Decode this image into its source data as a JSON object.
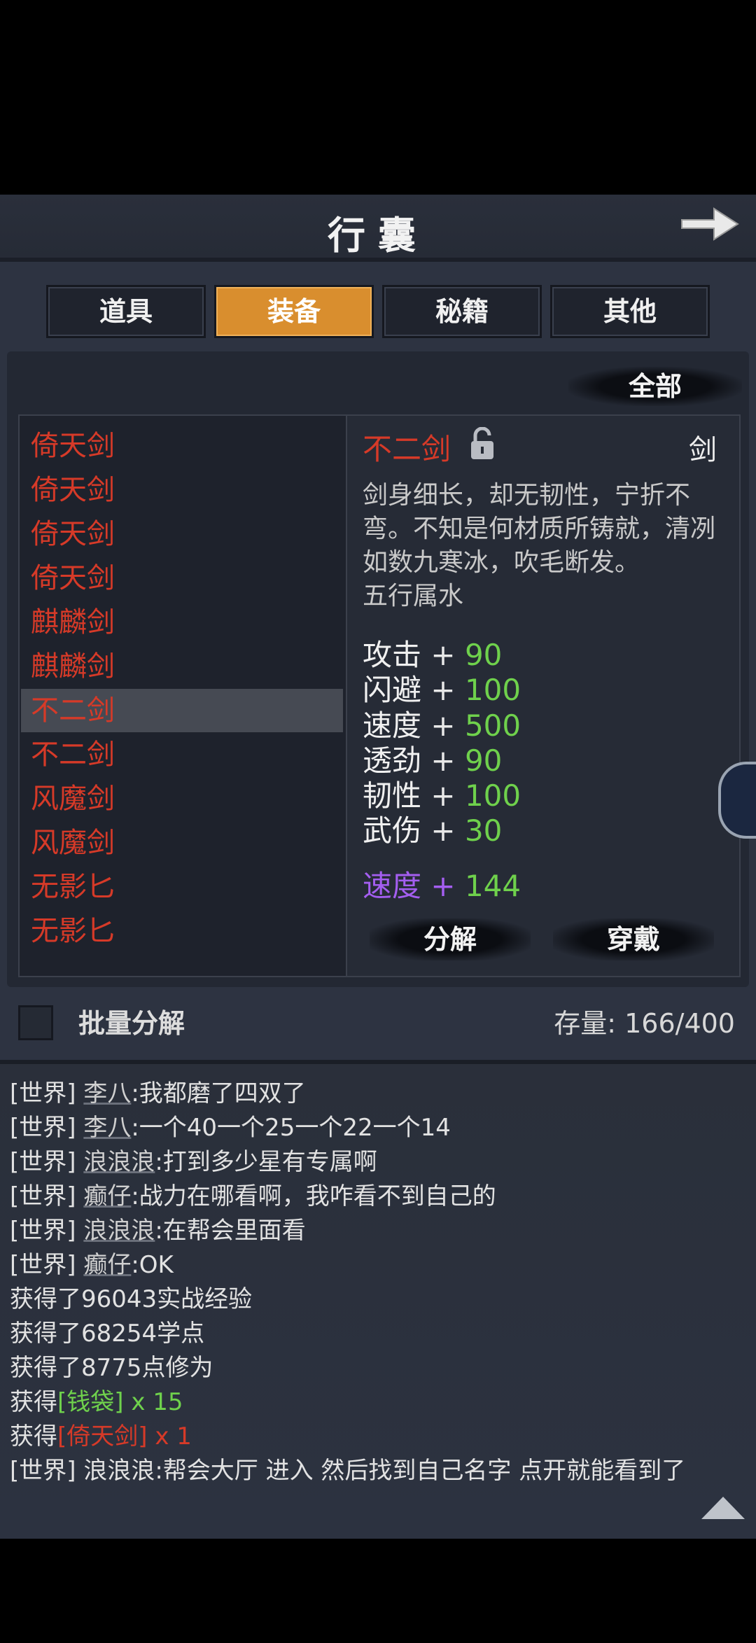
{
  "header": {
    "title": "行囊"
  },
  "tabs": [
    {
      "label": "道具",
      "active": false
    },
    {
      "label": "装备",
      "active": true
    },
    {
      "label": "秘籍",
      "active": false
    },
    {
      "label": "其他",
      "active": false
    }
  ],
  "filter": {
    "label": "全部"
  },
  "items": [
    {
      "name": "倚天剑"
    },
    {
      "name": "倚天剑"
    },
    {
      "name": "倚天剑"
    },
    {
      "name": "倚天剑"
    },
    {
      "name": "麒麟剑"
    },
    {
      "name": "麒麟剑"
    },
    {
      "name": "不二剑",
      "selected": true
    },
    {
      "name": "不二剑"
    },
    {
      "name": "风魔剑"
    },
    {
      "name": "风魔剑"
    },
    {
      "name": "无影匕"
    },
    {
      "name": "无影匕"
    }
  ],
  "detail": {
    "name": "不二剑",
    "type": "剑",
    "description": "剑身细长，却无韧性，宁折不弯。不知是何材质所铸就，清冽如数九寒冰，吹毛断发。",
    "element": "五行属水",
    "stats": [
      {
        "key": "攻击",
        "plus": "+",
        "value": "90"
      },
      {
        "key": "闪避",
        "plus": "+",
        "value": "100"
      },
      {
        "key": "速度",
        "plus": "+",
        "value": "500"
      },
      {
        "key": "透劲",
        "plus": "+",
        "value": "90"
      },
      {
        "key": "韧性",
        "plus": "+",
        "value": "100"
      },
      {
        "key": "武伤",
        "plus": "+",
        "value": "30"
      }
    ],
    "bonus": {
      "key": "速度",
      "plus": "+",
      "value": "144"
    },
    "decompose_label": "分解",
    "equip_label": "穿戴"
  },
  "footer": {
    "batch_label": "批量分解",
    "storage_label": "存量:",
    "storage_value": "166/400"
  },
  "chat": [
    {
      "channel": "[世界]",
      "who": "李八",
      "msg": ":我都磨了四双了"
    },
    {
      "channel": "[世界]",
      "who": "李八",
      "msg": ":一个40一个25一个22一个14"
    },
    {
      "channel": "[世界]",
      "who": "浪浪浪",
      "msg": ":打到多少星有专属啊"
    },
    {
      "channel": "[世界]",
      "who": "癫仔",
      "msg": ":战力在哪看啊，我咋看不到自己的"
    },
    {
      "channel": "[世界]",
      "who": "浪浪浪",
      "msg": ":在帮会里面看"
    },
    {
      "channel": "[世界]",
      "who": "癫仔",
      "msg": ":OK"
    },
    {
      "text": "获得了96043实战经验"
    },
    {
      "text": "获得了68254学点"
    },
    {
      "text": "获得了8775点修为"
    },
    {
      "prefix": "获得",
      "item": "[钱袋]",
      "count": " x 15",
      "color": "green"
    },
    {
      "prefix": "获得",
      "item": "[倚天剑]",
      "count": " x 1",
      "color": "red"
    },
    {
      "channel": "[世界]",
      "who": "浪浪浪",
      "msg": ":帮会大厅 进入 然后找到自己名字 点开就能看到了"
    }
  ],
  "colors": {
    "accent": "#d98e2e",
    "item_red": "#d63a28",
    "stat_green": "#6fd14c",
    "bonus_purple": "#a45ef0"
  }
}
